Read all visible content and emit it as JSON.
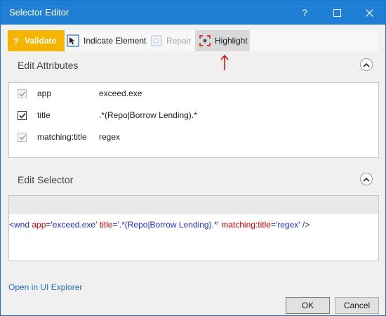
{
  "window": {
    "title": "Selector Editor",
    "controls": {
      "help": "?",
      "maximize": "☐",
      "close": "✕"
    }
  },
  "toolbar": {
    "validate": {
      "icon": "?",
      "label": "Validate"
    },
    "indicate": {
      "label": "Indicate Element"
    },
    "repair": {
      "label": "Repair"
    },
    "highlight": {
      "label": "Highlight"
    }
  },
  "attributes": {
    "title": "Edit Attributes",
    "items": [
      {
        "name": "app",
        "value": "exceed.exe",
        "checked": true,
        "disabled": true
      },
      {
        "name": "title",
        "value": ".*(Repo|Borrow Lending).*",
        "checked": true,
        "disabled": false
      },
      {
        "name": "matching:title",
        "value": "regex",
        "checked": true,
        "disabled": true
      }
    ]
  },
  "selector": {
    "title": "Edit Selector",
    "tag": "wnd",
    "attrs": [
      {
        "name": "app",
        "value": "exceed.exe"
      },
      {
        "name": "title",
        "value": ".*(Repo|Borrow Lending).*"
      },
      {
        "name": "matching:title",
        "value": "regex"
      }
    ],
    "open": "<",
    "close": " />"
  },
  "footer": {
    "explorer_link": "Open in UI Explorer",
    "ok": "OK",
    "cancel": "Cancel"
  },
  "colors": {
    "titlebar": "#1f7fd4",
    "validate": "#f4b400",
    "highlight_bg": "#d9d9d9",
    "arrow": "#e00000",
    "link": "#1f6fc5"
  }
}
